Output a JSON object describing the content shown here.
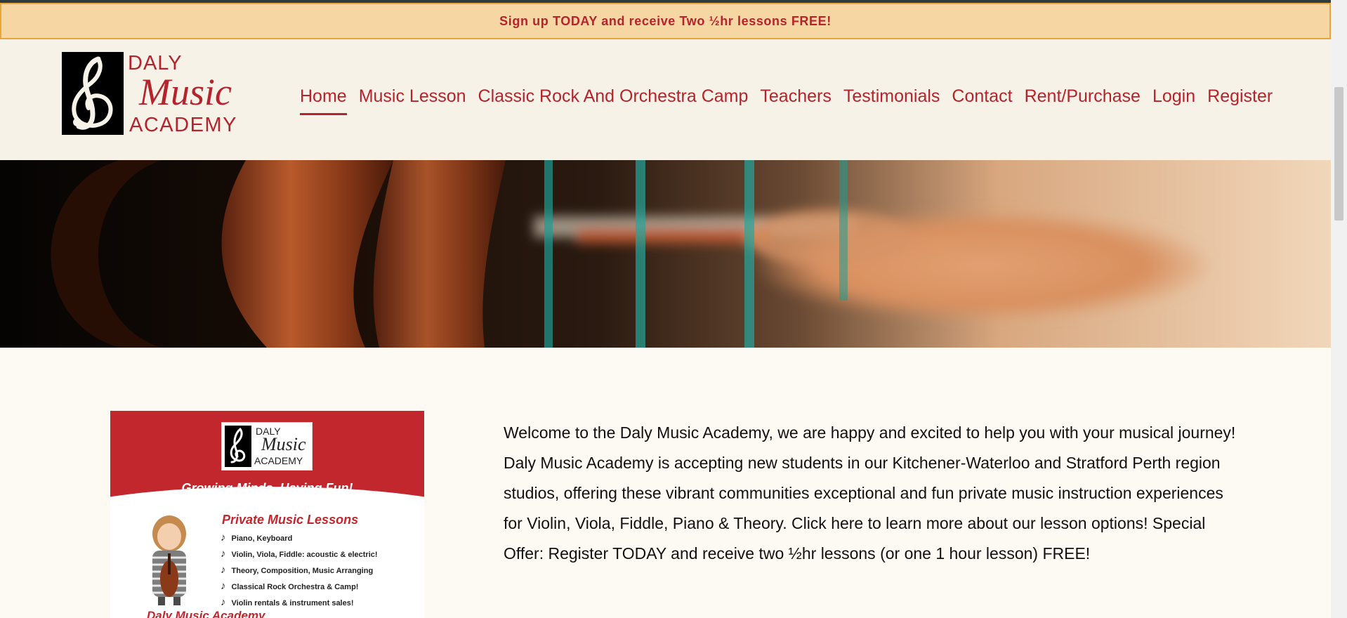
{
  "promo": {
    "text": "Sign up TODAY and receive Two ½hr lessons FREE!"
  },
  "logo": {
    "line1": "DALY",
    "line2": "Music",
    "line3": "ACADEMY"
  },
  "nav": [
    {
      "label": "Home",
      "active": true
    },
    {
      "label": "Music Lesson"
    },
    {
      "label": "Classic Rock And Orchestra Camp"
    },
    {
      "label": "Teachers"
    },
    {
      "label": "Testimonials"
    },
    {
      "label": "Contact"
    },
    {
      "label": "Rent/Purchase"
    },
    {
      "label": "Login"
    },
    {
      "label": "Register"
    }
  ],
  "flyer": {
    "logo": {
      "line1": "DALY",
      "line2": "Music",
      "line3": "ACADEMY"
    },
    "tagline": "Growing Minds, Having Fun!",
    "heading": "Private Music Lessons",
    "items": [
      "Piano, Keyboard",
      "Violin, Viola, Fiddle: acoustic & electric!",
      "Theory, Composition, Music Arranging",
      "Classical Rock Orchestra & Camp!",
      "Violin rentals & instrument sales!"
    ],
    "footer": "Daly Music Academy"
  },
  "welcome": {
    "text": "Welcome to the Daly Music Academy, we are happy and excited to help you with your musical journey! Daly Music Academy is accepting new students in our Kitchener-Waterloo and Stratford Perth region studios, offering these vibrant communities exceptional and fun private music instruction experiences for Violin, Viola, Fiddle, Piano & Theory. Click here to learn more about our lesson options! Special Offer: Register TODAY and receive two ½hr lessons (or one 1 hour lesson) FREE!"
  },
  "colors": {
    "brand_red": "#b5242c",
    "promo_bg": "#f6d6a3",
    "header_bg": "#f6f2e7",
    "page_bg": "#fdfaf3"
  }
}
